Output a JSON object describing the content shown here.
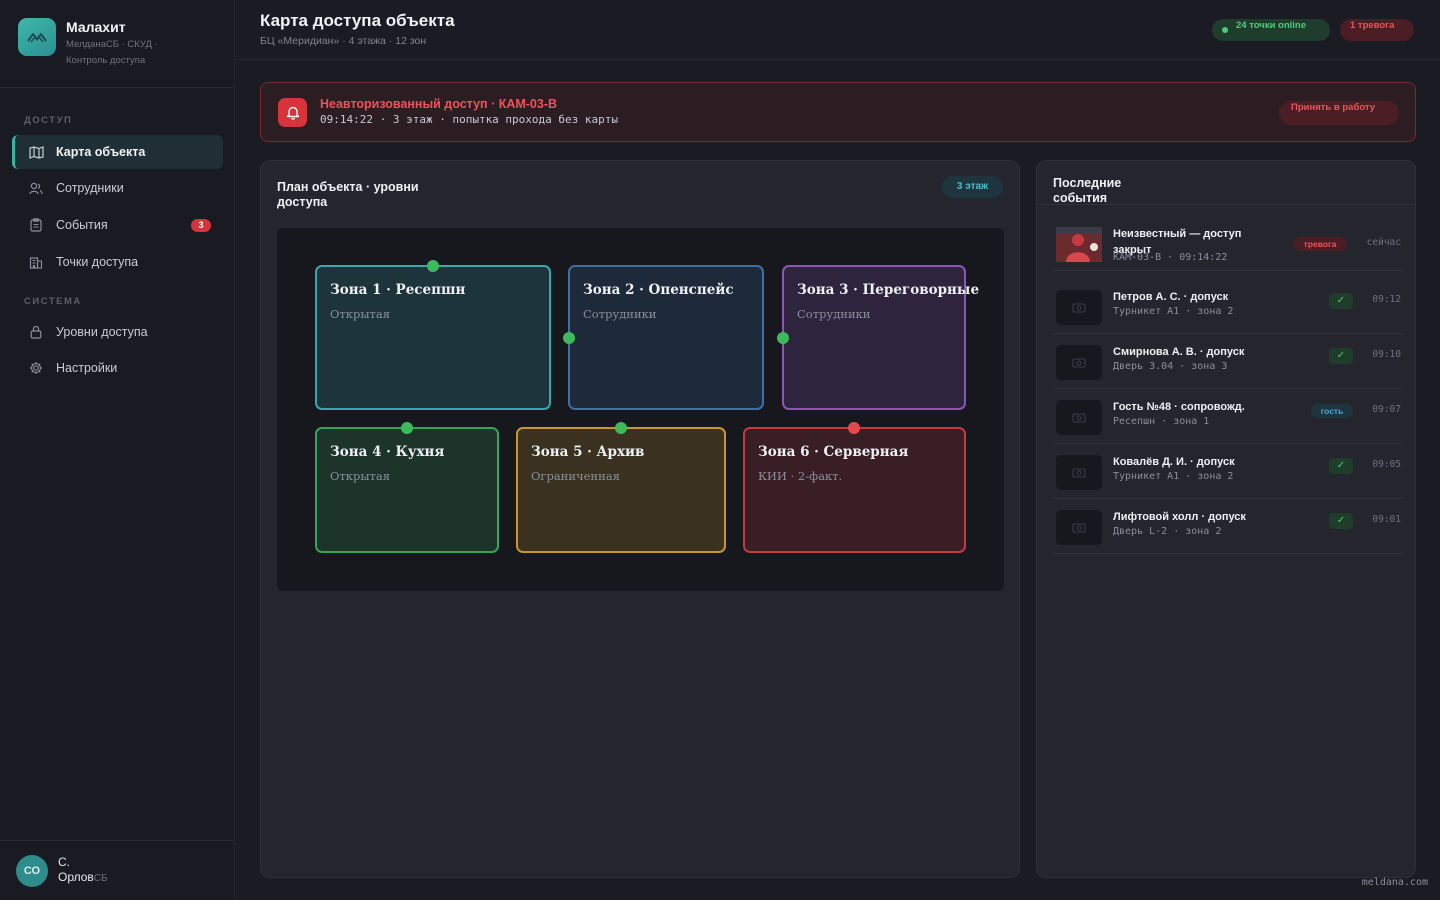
{
  "brand": {
    "name": "Малахит",
    "subtitle": "МелданаСБ · СКУД · Контроль доступа"
  },
  "sidebar": {
    "sections": [
      {
        "label": "ДОСТУП"
      },
      {
        "label": "СИСТЕМА"
      }
    ],
    "items": [
      {
        "label": "Карта объекта",
        "icon": "map-icon",
        "active": true
      },
      {
        "label": "Сотрудники",
        "icon": "users-icon"
      },
      {
        "label": "События",
        "icon": "clipboard-icon",
        "badge": "3"
      },
      {
        "label": "Точки доступа",
        "icon": "building-icon"
      },
      {
        "label": "Уровни доступа",
        "icon": "lock-icon"
      },
      {
        "label": "Настройки",
        "icon": "gear-icon"
      }
    ]
  },
  "user": {
    "initials": "СО",
    "name": "С.",
    "surname": "Орлов",
    "role": "СБ"
  },
  "header": {
    "title": "Карта доступа объекта",
    "subtitle": "БЦ «Меридиан» · 4 этажа · 12 зон",
    "online_pill": "24 точки online",
    "alarm_pill": "1 тревога"
  },
  "alert": {
    "title": "Неавторизованный доступ · КАМ-03-В",
    "subtitle": "09:14:22 · 3 этаж · попытка прохода без карты",
    "button": "Принять в работу"
  },
  "plan": {
    "title": "План объекта · уровни доступа",
    "floor": "3 этаж",
    "zones": [
      {
        "name": "Зона 1 · Ресепшн",
        "level": "Открытая",
        "color": "#3aa6ad"
      },
      {
        "name": "Зона 2 · Опенспейс",
        "level": "Сотрудники",
        "color": "#3d6fa8"
      },
      {
        "name": "Зона 3 · Переговорные",
        "level": "Сотрудники",
        "color": "#8e55b8"
      },
      {
        "name": "Зона 4 · Кухня",
        "level": "Открытая",
        "color": "#35a35a"
      },
      {
        "name": "Зона 5 · Архив",
        "level": "Ограниченная",
        "color": "#c9952e"
      },
      {
        "name": "Зона 6 · Серверная",
        "level": "КИИ · 2-факт.",
        "color": "#c7393f"
      }
    ],
    "point_colors": {
      "ok": "#3dbb5c",
      "alarm": "#e5484d"
    }
  },
  "events": {
    "title": "Последние события",
    "items": [
      {
        "title": "Неизвестный — доступ закрыт",
        "sub": "КАМ-03-В · 09:14:22",
        "tag": "тревога",
        "time": "сейчас"
      },
      {
        "title": "Петров А. С. · допуск",
        "sub": "Турникет А1 · зона 2",
        "status": "✓",
        "time": "09:12"
      },
      {
        "title": "Смирнова А. В. · допуск",
        "sub": "Дверь 3.04 · зона 3",
        "status": "✓",
        "time": "09:10"
      },
      {
        "title": "Гость №48 · сопровожд.",
        "sub": "Ресепшн · зона 1",
        "tag": "гость",
        "time": "09:07"
      },
      {
        "title": "Ковалёв Д. И. · допуск",
        "sub": "Турникет А1 · зона 2",
        "status": "✓",
        "time": "09:05"
      },
      {
        "title": "Лифтовой холл · допуск",
        "sub": "Дверь L-2 · зона 2",
        "status": "✓",
        "time": "09:01"
      }
    ]
  },
  "footer": {
    "mark": "meldana.com"
  }
}
